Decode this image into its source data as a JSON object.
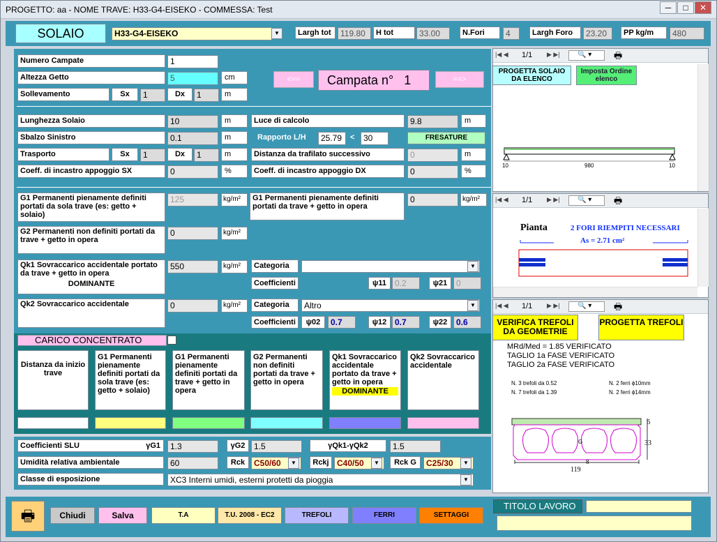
{
  "title": "PROGETTO: aa - NOME TRAVE: H33-G4-EISEKO - COMMESSA: Test",
  "win_btns": {
    "min": "─",
    "max": "□",
    "close": "✕"
  },
  "top": {
    "solaio": "SOLAIO",
    "trave": "H33-G4-EISEKO",
    "largh_tot_l": "Largh tot",
    "largh_tot": "119.80",
    "h_tot_l": "H tot",
    "h_tot": "33.00",
    "nfori_l": "N.Fori",
    "nfori": "4",
    "largh_foro_l": "Largh Foro",
    "largh_foro": "23.20",
    "pp_l": "PP kg/m",
    "pp": "480"
  },
  "campate": {
    "num_l": "Numero Campate",
    "num": "1",
    "alt_l": "Altezza Getto",
    "alt": "5",
    "alt_u": "cm",
    "soll_l": "Sollevamento",
    "sx": "Sx",
    "sx_v": "1",
    "dx": "Dx",
    "dx_v": "1",
    "m": "m",
    "prev": "<==",
    "next": "==>",
    "campata": "Campata n°",
    "campata_n": "1"
  },
  "geo": {
    "lung_l": "Lunghezza Solaio",
    "lung": "10",
    "luce_l": "Luce di calcolo",
    "luce": "9.8",
    "sbalzo_l": "Sbalzo Sinistro",
    "sbalzo": "0.1",
    "rapp_l": "Rapporto L/H",
    "rapp": "25.79",
    "lt": "<",
    "rapp_max": "30",
    "fresature": "FRESATURE",
    "trasp_l": "Trasporto",
    "t_sx": "Sx",
    "t_sx_v": "1",
    "t_dx": "Dx",
    "t_dx_v": "1",
    "dist_l": "Distanza da trafilato successivo",
    "dist": "0",
    "coeff_sx_l": "Coeff. di incastro appoggio SX",
    "coeff_sx": "0",
    "coeff_dx_l": "Coeff. di incastro appoggio DX",
    "coeff_dx": "0",
    "m": "m",
    "pct": "%"
  },
  "loads": {
    "g1a_l": "G1 Permanenti pienamente definiti portati da sola trave (es: getto + solaio)",
    "g1a": "125",
    "g1b_l": "G1 Permanenti pienamente definiti portati da trave + getto in opera",
    "g1b": "0",
    "g2_l": "G2 Permanenti non definiti portati da trave + getto in opera",
    "g2": "0",
    "qk1_l": "Qk1 Sovraccarico accidentale portato da trave + getto in opera",
    "qk1_dom": "DOMINANTE",
    "qk1": "550",
    "qk2_l": "Qk2  Sovraccarico accidentale",
    "qk2": "0",
    "kgm": "kg/m²",
    "cat_l": "Categoria",
    "cat1": "",
    "coeff_l": "Coefficienti",
    "psi11_l": "ψ11",
    "psi11": "0.2",
    "psi21_l": "ψ21",
    "psi21": "0",
    "cat2": "Altro",
    "psi02_l": "ψ02",
    "psi02": "0.7",
    "psi12_l": "ψ12",
    "psi12": "0.7",
    "psi22_l": "ψ22",
    "psi22": "0.6"
  },
  "conc": {
    "title": "CARICO CONCENTRATO",
    "h1": "Distanza da inizio trave",
    "h2": "G1 Permanenti pienamente definiti portati da sola trave (es: getto + solaio)",
    "h3": "G1 Permanenti pienamente definiti portati da trave + getto in opera",
    "h4": "G2 Permanenti non definiti portati da trave + getto in opera",
    "h5": "Qk1 Sovraccarico accidentale portato da trave + getto in opera",
    "h5_dom": "DOMINANTE",
    "h6": "Qk2 Sovraccarico accidentale"
  },
  "slu": {
    "coeff_l": "Coefficienti SLU",
    "g1_l": "γG1",
    "g1": "1.3",
    "g2_l": "γG2",
    "g2": "1.5",
    "qk_l": "γQk1-γQk2",
    "qk": "1.5",
    "umid_l": "Umidità relativa ambientale",
    "umid": "60",
    "rck_l": "Rck",
    "rck": "C50/60",
    "rckj_l": "Rckj",
    "rckj": "C40/50",
    "rckg_l": "Rck G",
    "rckg": "C25/30",
    "classe_l": "Classe di esposizione",
    "classe": "XC3  Interni umidi, esterni protetti da pioggia"
  },
  "bottom": {
    "chiudi": "Chiudi",
    "salva": "Salva",
    "ta": "T.A",
    "tu": "T.U. 2008 - EC2",
    "trefoli": "TREFOLI",
    "ferri": "FERRI",
    "settaggi": "SETTAGGI",
    "titolo": "TITOLO LAVORO"
  },
  "right": {
    "page1": "1/1",
    "page2": "1/1",
    "page3": "1/1",
    "prog_solaio": "PROGETTA SOLAIO DA ELENCO",
    "imposta": "Imposta Ordine elenco",
    "b_left": "10",
    "b_mid": "980",
    "b_right": "10",
    "pianta": "Pianta",
    "fori": "2  FORI  RIEMPITI  NECESSARI",
    "as": "As = 2.71 cm²",
    "verifica": "VERIFICA TREFOLI DA GEOMETRIE",
    "progetta_t": "PROGETTA TREFOLI",
    "res1": "MRd/Med = 1.85 VERIFICATO",
    "res2": "TAGLIO 1a FASE VERIFICATO",
    "res3": "TAGLIO 2a FASE VERIFICATO",
    "tr1": "N. 3 trefoli da 0.52",
    "tr2": "N. 7 trefoli da 1.39",
    "fe1": "N. 2 ferri  ϕ10mm",
    "fe2": "N. 2 ferri  ϕ14mm",
    "d5": "5",
    "d33": "33",
    "d8": "8",
    "d119": "119",
    "g": "G"
  },
  "colors": {
    "bg_blue": "#3b98b5",
    "bg_teal": "#197b80",
    "cyan": "#a8ffff",
    "pink": "#ffc0ee",
    "yellow": "#ffff7f",
    "green": "#80ff80",
    "purple": "#8080ff",
    "orange": "#ff8000"
  }
}
